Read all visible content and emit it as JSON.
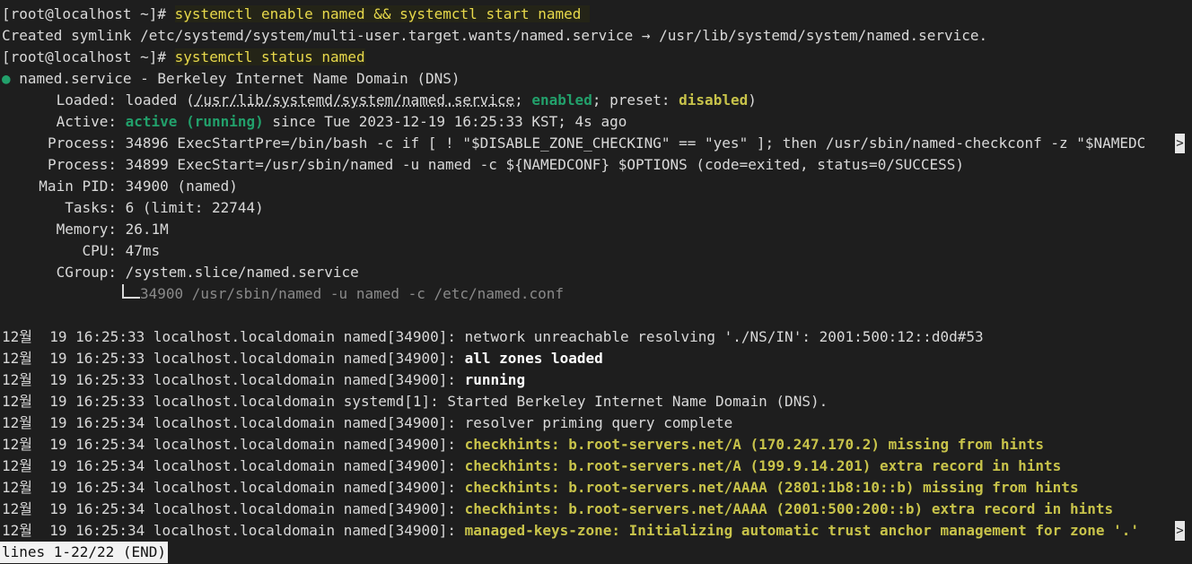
{
  "prompt": "[root@localhost ~]# ",
  "cmd1": "systemctl enable named && systemctl start named ",
  "out1": "Created symlink /etc/systemd/system/multi-user.target.wants/named.service → /usr/lib/systemd/system/named.service.",
  "cmd2": "systemctl status named",
  "status_dot": "●",
  "unit_title": " named.service - Berkeley Internet Name Domain (DNS)",
  "loaded": {
    "label": "Loaded:",
    "pre": " loaded (",
    "path": "/usr/lib/systemd/system/named.service",
    "sep": "; ",
    "enabled": "enabled",
    "mid": "; preset: ",
    "preset": "disabled",
    "end": ")"
  },
  "active": {
    "label": "Active:",
    "state": "active (running)",
    "since": " since Tue 2023-12-19 16:25:33 KST; 4s ago"
  },
  "process1": {
    "label": "Process:",
    "value": " 34896 ExecStartPre=/bin/bash -c if [ ! \"$DISABLE_ZONE_CHECKING\" == \"yes\" ]; then /usr/sbin/named-checkconf -z \"$NAMEDC"
  },
  "process2": {
    "label": "Process:",
    "value": " 34899 ExecStart=/usr/sbin/named -u named -c ${NAMEDCONF} $OPTIONS (code=exited, status=0/SUCCESS)"
  },
  "mainpid": {
    "label": "Main PID:",
    "value": " 34900 (named)"
  },
  "tasks": {
    "label": "Tasks:",
    "value": " 6 (limit: 22744)"
  },
  "memory": {
    "label": "Memory:",
    "value": " 26.1M"
  },
  "cpu": {
    "label": "CPU:",
    "value": " 47ms"
  },
  "cgroup": {
    "label": "CGroup:",
    "value": " /system.slice/named.service"
  },
  "cgroup_child": "34900 /usr/sbin/named -u named -c /etc/named.conf",
  "logs": [
    {
      "prefix": "12월  19 16:25:33 localhost.localdomain named[34900]: ",
      "msg": "network unreachable resolving './NS/IN': 2001:500:12::d0d#53",
      "style": "normal"
    },
    {
      "prefix": "12월  19 16:25:33 localhost.localdomain named[34900]: ",
      "msg": "all zones loaded",
      "style": "bold"
    },
    {
      "prefix": "12월  19 16:25:33 localhost.localdomain named[34900]: ",
      "msg": "running",
      "style": "bold"
    },
    {
      "prefix": "12월  19 16:25:33 localhost.localdomain systemd[1]: ",
      "msg": "Started Berkeley Internet Name Domain (DNS).",
      "style": "normal"
    },
    {
      "prefix": "12월  19 16:25:34 localhost.localdomain named[34900]: ",
      "msg": "resolver priming query complete",
      "style": "normal"
    },
    {
      "prefix": "12월  19 16:25:34 localhost.localdomain named[34900]: ",
      "msg": "checkhints: b.root-servers.net/A (170.247.170.2) missing from hints",
      "style": "warn"
    },
    {
      "prefix": "12월  19 16:25:34 localhost.localdomain named[34900]: ",
      "msg": "checkhints: b.root-servers.net/A (199.9.14.201) extra record in hints",
      "style": "warn"
    },
    {
      "prefix": "12월  19 16:25:34 localhost.localdomain named[34900]: ",
      "msg": "checkhints: b.root-servers.net/AAAA (2801:1b8:10::b) missing from hints",
      "style": "warn"
    },
    {
      "prefix": "12월  19 16:25:34 localhost.localdomain named[34900]: ",
      "msg": "checkhints: b.root-servers.net/AAAA (2001:500:200::b) extra record in hints",
      "style": "warn"
    },
    {
      "prefix": "12월  19 16:25:34 localhost.localdomain named[34900]: ",
      "msg": "managed-keys-zone: Initializing automatic trust anchor management for zone '.'",
      "style": "warn"
    }
  ],
  "truncation_marker": ">",
  "pager_status": "lines 1-22/22 (END)",
  "colors": {
    "background": "#1e1e1e",
    "command": "#e8d94b",
    "enabled_green": "#22a06b",
    "warn_yellow": "#c8c34a"
  }
}
